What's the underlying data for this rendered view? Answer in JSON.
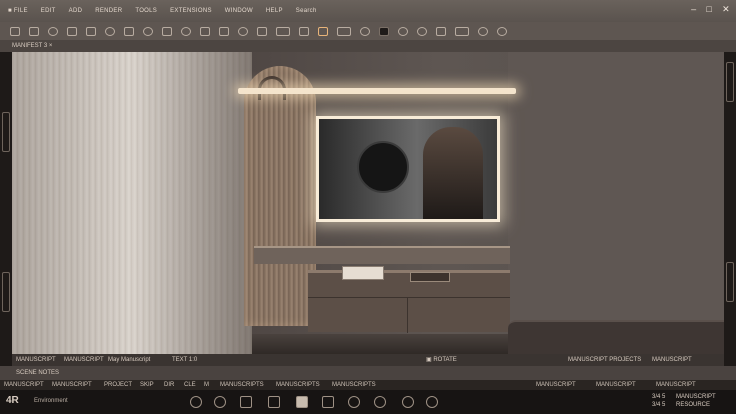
{
  "menubar": {
    "items": [
      "■ FILE",
      "EDIT",
      "ADD",
      "RENDER",
      "TOOLS",
      "EXTENSIONS",
      "WINDOW",
      "HELP",
      "Search"
    ]
  },
  "docbar": {
    "label": "MANIFEST  3 ×"
  },
  "status": {
    "left_a": "MANUSCRIPT",
    "left_b": "MANUSCRIPT",
    "left_c": "May Manuscript",
    "mid": "TEXT 1:0",
    "mid_b": "▣ ROTATE",
    "right_a": "MANUSCRIPT PROJECTS",
    "right_b": "MANUSCRIPT"
  },
  "status2": {
    "left": "SCENE NOTES",
    "right": ""
  },
  "status3": {
    "items": [
      "MANUSCRIPT",
      "MANUSCRIPT",
      "PROJECT",
      "SKIP",
      "DIR",
      "CLE",
      "M",
      "MANUSCRIPTS",
      "MANUSCRIPTS",
      "MANUSCRIPTS"
    ],
    "right_items": [
      "MANUSCRIPT",
      "MANUSCRIPT",
      "MANUSCRIPT"
    ]
  },
  "dock": {
    "logo": "4R",
    "project": "Environment",
    "ver_a": "3/4 5",
    "ver_b": "3/4 5",
    "right_a": "MANUSCRIPT",
    "right_b": "RESOURCE"
  },
  "colors": {
    "accent": "#e8b47a",
    "panel": "#5e5651",
    "dark": "#171413"
  }
}
